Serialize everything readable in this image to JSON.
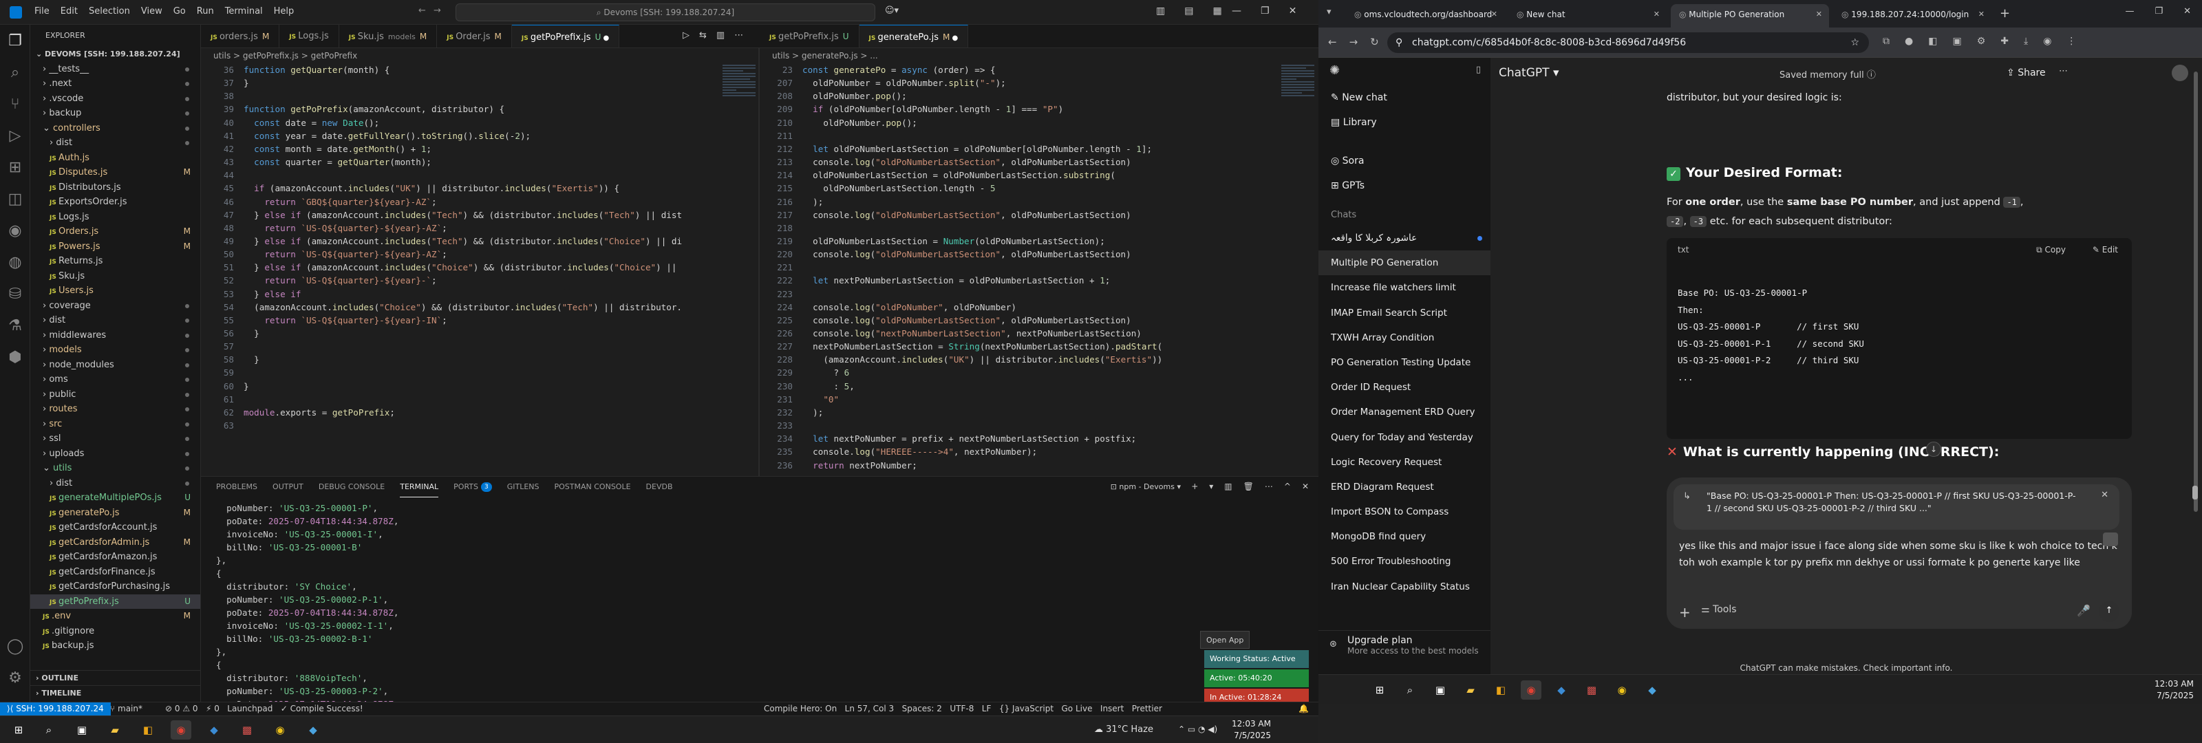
{
  "vscode": {
    "menu": [
      "File",
      "Edit",
      "Selection",
      "View",
      "Go",
      "Run",
      "Terminal",
      "Help"
    ],
    "command_center": "Devoms [SSH: 199.188.207.24]",
    "explorer_title": "EXPLORER",
    "workspace": "DEVOMS [SSH: 199.188.207.24]",
    "tree": [
      {
        "label": "__tests__",
        "indent": 1,
        "kind": "folder"
      },
      {
        "label": ".next",
        "indent": 1,
        "kind": "folder"
      },
      {
        "label": ".vscode",
        "indent": 1,
        "kind": "folder"
      },
      {
        "label": "backup",
        "indent": 1,
        "kind": "folder"
      },
      {
        "label": "controllers",
        "indent": 1,
        "kind": "folder-open",
        "mark": "dot",
        "color": "#e2c08d"
      },
      {
        "label": "dist",
        "indent": 2,
        "kind": "folder"
      },
      {
        "label": "Auth.js",
        "indent": 2,
        "kind": "file",
        "color": "#e2c08d"
      },
      {
        "label": "Disputes.js",
        "indent": 2,
        "kind": "file",
        "mark": "M",
        "color": "#e2c08d"
      },
      {
        "label": "Distributors.js",
        "indent": 2,
        "kind": "file"
      },
      {
        "label": "ExportsOrder.js",
        "indent": 2,
        "kind": "file"
      },
      {
        "label": "Logs.js",
        "indent": 2,
        "kind": "file"
      },
      {
        "label": "Orders.js",
        "indent": 2,
        "kind": "file",
        "mark": "M",
        "color": "#e2c08d"
      },
      {
        "label": "Powers.js",
        "indent": 2,
        "kind": "file",
        "mark": "M",
        "color": "#e2c08d"
      },
      {
        "label": "Returns.js",
        "indent": 2,
        "kind": "file"
      },
      {
        "label": "Sku.js",
        "indent": 2,
        "kind": "file"
      },
      {
        "label": "Users.js",
        "indent": 2,
        "kind": "file",
        "color": "#e2c08d"
      },
      {
        "label": "coverage",
        "indent": 1,
        "kind": "folder"
      },
      {
        "label": "dist",
        "indent": 1,
        "kind": "folder"
      },
      {
        "label": "middlewares",
        "indent": 1,
        "kind": "folder"
      },
      {
        "label": "models",
        "indent": 1,
        "kind": "folder",
        "color": "#e2c08d"
      },
      {
        "label": "node_modules",
        "indent": 1,
        "kind": "folder"
      },
      {
        "label": "oms",
        "indent": 1,
        "kind": "folder"
      },
      {
        "label": "public",
        "indent": 1,
        "kind": "folder"
      },
      {
        "label": "routes",
        "indent": 1,
        "kind": "folder",
        "color": "#e2c08d"
      },
      {
        "label": "src",
        "indent": 1,
        "kind": "folder",
        "color": "#e2c08d"
      },
      {
        "label": "ssl",
        "indent": 1,
        "kind": "folder"
      },
      {
        "label": "uploads",
        "indent": 1,
        "kind": "folder"
      },
      {
        "label": "utils",
        "indent": 1,
        "kind": "folder-open",
        "color": "#73c991"
      },
      {
        "label": "dist",
        "indent": 2,
        "kind": "folder"
      },
      {
        "label": "generateMultiplePOs.js",
        "indent": 2,
        "kind": "file",
        "mark": "U",
        "color": "#73c991"
      },
      {
        "label": "generatePo.js",
        "indent": 2,
        "kind": "file",
        "mark": "M",
        "color": "#e2c08d"
      },
      {
        "label": "getCardsforAccount.js",
        "indent": 2,
        "kind": "file"
      },
      {
        "label": "getCardsforAdmin.js",
        "indent": 2,
        "kind": "file",
        "mark": "M",
        "color": "#e2c08d"
      },
      {
        "label": "getCardsforAmazon.js",
        "indent": 2,
        "kind": "file"
      },
      {
        "label": "getCardsforFinance.js",
        "indent": 2,
        "kind": "file"
      },
      {
        "label": "getCardsforPurchasing.js",
        "indent": 2,
        "kind": "file"
      },
      {
        "label": "getPoPrefix.js",
        "indent": 2,
        "kind": "file",
        "mark": "U",
        "color": "#73c991",
        "selected": true
      },
      {
        "label": ".env",
        "indent": 1,
        "kind": "file",
        "mark": "M",
        "color": "#e2c08d"
      },
      {
        "label": ".gitignore",
        "indent": 1,
        "kind": "file"
      },
      {
        "label": "backup.js",
        "indent": 1,
        "kind": "file"
      }
    ],
    "outline": "OUTLINE",
    "timeline": "TIMELINE",
    "left_tabs": [
      {
        "label": "orders.js",
        "mark": "M"
      },
      {
        "label": "Logs.js",
        "mark": ""
      },
      {
        "label": "Sku.js",
        "extra": "models",
        "mark": "M"
      },
      {
        "label": "Order.js",
        "mark": "M"
      },
      {
        "label": "getPoPrefix.js",
        "mark": "U",
        "active": true
      }
    ],
    "right_tabs": [
      {
        "label": "getPoPrefix.js",
        "mark": "U"
      },
      {
        "label": "generatePo.js",
        "mark": "M",
        "active": true
      }
    ],
    "left_breadcrumb": "utils > getPoPrefix.js > getPoPrefix",
    "right_breadcrumb": "utils > generatePo.js > ...",
    "left_code": [
      {
        "n": "36",
        "t": "function getQuarter(month) {"
      },
      {
        "n": "37",
        "t": "}"
      },
      {
        "n": "38",
        "t": ""
      },
      {
        "n": "39",
        "t": "function getPoPrefix(amazonAccount, distributor) {"
      },
      {
        "n": "40",
        "t": "  const date = new Date();"
      },
      {
        "n": "41",
        "t": "  const year = date.getFullYear().toString().slice(-2);"
      },
      {
        "n": "42",
        "t": "  const month = date.getMonth() + 1;"
      },
      {
        "n": "43",
        "t": "  const quarter = getQuarter(month);"
      },
      {
        "n": "44",
        "t": ""
      },
      {
        "n": "45",
        "t": "  if (amazonAccount.includes(\"UK\") || distributor.includes(\"Exertis\")) {"
      },
      {
        "n": "46",
        "t": "    return `GBQ${quarter}${year}-AZ`;"
      },
      {
        "n": "47",
        "t": "  } else if (amazonAccount.includes(\"Tech\") && (distributor.includes(\"Tech\") || dist"
      },
      {
        "n": "48",
        "t": "    return `US-Q${quarter}-${year}-AZ`;"
      },
      {
        "n": "49",
        "t": "  } else if (amazonAccount.includes(\"Tech\") && (distributor.includes(\"Choice\") || di"
      },
      {
        "n": "50",
        "t": "    return `US-Q${quarter}-${year}-AZ`;"
      },
      {
        "n": "51",
        "t": "  } else if (amazonAccount.includes(\"Choice\") && (distributor.includes(\"Choice\") ||"
      },
      {
        "n": "52",
        "t": "    return `US-Q${quarter}-${year}-`;"
      },
      {
        "n": "53",
        "t": "  } else if"
      },
      {
        "n": "54",
        "t": "  (amazonAccount.includes(\"Choice\") && (distributor.includes(\"Tech\") || distributor."
      },
      {
        "n": "55",
        "t": "    return `US-Q${quarter}-${year}-IN`;"
      },
      {
        "n": "56",
        "t": "  }"
      },
      {
        "n": "57",
        "t": ""
      },
      {
        "n": "58",
        "t": "  }"
      },
      {
        "n": "59",
        "t": ""
      },
      {
        "n": "60",
        "t": "}"
      },
      {
        "n": "61",
        "t": ""
      },
      {
        "n": "62",
        "t": "module.exports = getPoPrefix;"
      },
      {
        "n": "63",
        "t": ""
      }
    ],
    "right_code": [
      {
        "n": "23",
        "t": "const generatePo = async (order) => {"
      },
      {
        "n": "207",
        "t": "  oldPoNumber = oldPoNumber.split(\"-\");"
      },
      {
        "n": "208",
        "t": "  oldPoNumber.pop();"
      },
      {
        "n": "209",
        "t": "  if (oldPoNumber[oldPoNumber.length - 1] === \"P\")"
      },
      {
        "n": "210",
        "t": "    oldPoNumber.pop();"
      },
      {
        "n": "211",
        "t": ""
      },
      {
        "n": "212",
        "t": "  let oldPoNumberLastSection = oldPoNumber[oldPoNumber.length - 1];"
      },
      {
        "n": "213",
        "t": "  console.log(\"oldPoNumberLastSection\", oldPoNumberLastSection)"
      },
      {
        "n": "214",
        "t": "  oldPoNumberLastSection = oldPoNumberLastSection.substring("
      },
      {
        "n": "215",
        "t": "    oldPoNumberLastSection.length - 5"
      },
      {
        "n": "216",
        "t": "  );"
      },
      {
        "n": "217",
        "t": "  console.log(\"oldPoNumberLastSection\", oldPoNumberLastSection)"
      },
      {
        "n": "218",
        "t": ""
      },
      {
        "n": "219",
        "t": "  oldPoNumberLastSection = Number(oldPoNumberLastSection);"
      },
      {
        "n": "220",
        "t": "  console.log(\"oldPoNumberLastSection\", oldPoNumberLastSection)"
      },
      {
        "n": "221",
        "t": ""
      },
      {
        "n": "222",
        "t": "  let nextPoNumberLastSection = oldPoNumberLastSection + 1;"
      },
      {
        "n": "223",
        "t": ""
      },
      {
        "n": "224",
        "t": "  console.log(\"oldPoNumber\", oldPoNumber)"
      },
      {
        "n": "225",
        "t": "  console.log(\"oldPoNumberLastSection\", oldPoNumberLastSection)"
      },
      {
        "n": "226",
        "t": "  console.log(\"nextPoNumberLastSection\", nextPoNumberLastSection)"
      },
      {
        "n": "227",
        "t": "  nextPoNumberLastSection = String(nextPoNumberLastSection).padStart("
      },
      {
        "n": "228",
        "t": "    (amazonAccount.includes(\"UK\") || distributor.includes(\"Exertis\"))"
      },
      {
        "n": "229",
        "t": "      ? 6"
      },
      {
        "n": "230",
        "t": "      : 5,"
      },
      {
        "n": "231",
        "t": "    \"0\""
      },
      {
        "n": "232",
        "t": "  );"
      },
      {
        "n": "233",
        "t": ""
      },
      {
        "n": "234",
        "t": "  let nextPoNumber = prefix + nextPoNumberLastSection + postfix;"
      },
      {
        "n": "235",
        "t": "  console.log(\"HEREEE----->4\", nextPoNumber);"
      },
      {
        "n": "236",
        "t": "  return nextPoNumber;"
      }
    ],
    "panel_tabs": [
      "PROBLEMS",
      "OUTPUT",
      "DEBUG CONSOLE",
      "TERMINAL",
      "PORTS",
      "GITLENS",
      "POSTMAN CONSOLE",
      "DEVDB"
    ],
    "ports_badge": "3",
    "terminal_name": "npm - Devoms",
    "terminal_lines": [
      "  poNumber: 'US-Q3-25-00001-P',",
      "  poDate: 2025-07-04T18:44:34.878Z,",
      "  invoiceNo: 'US-Q3-25-00001-I',",
      "  billNo: 'US-Q3-25-00001-B'",
      "},",
      "{",
      "  distributor: 'SY Choice',",
      "  poNumber: 'US-Q3-25-00002-P-1',",
      "  poDate: 2025-07-04T18:44:34.878Z,",
      "  invoiceNo: 'US-Q3-25-00002-I-1',",
      "  billNo: 'US-Q3-25-00002-B-1'",
      "},",
      "{",
      "  distributor: '888VoipTech',",
      "  poNumber: 'US-Q3-25-00003-P-2',",
      "  poDate: 2025-07-04T18:44:34.878Z,"
    ],
    "open_app": "Open App",
    "working_status": "Working Status: Active",
    "active_time": "Active: 05:40:20",
    "inactive_time": "In Active: 01:28:24",
    "status_left": "SSH: 199.188.207.24",
    "status_branch": "main*",
    "status_items": "⊘ 0 ⚠ 0   ⚡ 0   Launchpad   ✓ Compile Success!",
    "status_right": "Compile Hero: On   Ln 57, Col 3   Spaces: 2   UTF-8   LF   {} JavaScript   Go Live   Insert   Prettier",
    "tray_weather": "31°C  Haze",
    "tray_time": "12:03 AM",
    "tray_date": "7/5/2025"
  },
  "chrome": {
    "tabs": [
      {
        "label": "oms.vcloudtech.org/dashboard"
      },
      {
        "label": "New chat"
      },
      {
        "label": "Multiple PO Generation",
        "active": true
      },
      {
        "label": "199.188.207.24:10000/login"
      }
    ],
    "url": "chatgpt.com/c/685d4b0f-8c8c-8008-b3cd-8696d7d49f56",
    "model": "ChatGPT",
    "saved_memory": "Saved memory full",
    "share": "Share",
    "side": {
      "new_chat": "New chat",
      "library": "Library",
      "sora": "Sora",
      "gpts": "GPTs",
      "chats_label": "Chats",
      "chats": [
        "عاشورہ کربلا کا واقعہ",
        "Multiple PO Generation",
        "Increase file watchers limit",
        "IMAP Email Search Script",
        "TXWH Array Condition",
        "PO Generation Testing Update",
        "Order ID Request",
        "Order Management ERD Query",
        "Query for Today and Yesterday",
        "Logic Recovery Request",
        "ERD Diagram Request",
        "Import BSON to Compass",
        "MongoDB find query",
        "500 Error Troubleshooting",
        "Iran Nuclear Capability Status"
      ],
      "upgrade": "Upgrade plan",
      "upgrade_sub": "More access to the best models"
    },
    "msg_top": "distributor, but your desired logic is:",
    "desired_heading": "Your Desired Format:",
    "desired_line_a": "For ",
    "desired_line_b": "one order",
    "desired_line_c": ", use the ",
    "desired_line_d": "same base PO number",
    "desired_line_e": ", and just append",
    "desired_line_f": "-1",
    "desired_line2_a": "-2",
    "desired_line2_b": "-3",
    "desired_line2_c": " etc. for each subsequent distributor:",
    "code_lang": "txt",
    "copy": "Copy",
    "edit": "Edit",
    "code_block": [
      "Base PO: US-Q3-25-00001-P",
      "Then:",
      "US-Q3-25-00001-P       // first SKU",
      "US-Q3-25-00001-P-1     // second SKU",
      "US-Q3-25-00001-P-2     // third SKU",
      "..."
    ],
    "wrong_heading": "What is currently happening (INCORRECT):",
    "quote": "\"Base PO: US-Q3-25-00001-P Then: US-Q3-25-00001-P // first SKU US-Q3-25-00001-P-1 // second SKU US-Q3-25-00001-P-2 // third SKU ...\"",
    "draft": "yes like this and major issue i face along side when some sku is like k woh choice to tech k toh woh example k tor py prefix mn dekhye or ussi formate k po generte karye like",
    "tools": "Tools",
    "disclaimer": "ChatGPT can make mistakes. Check important info.",
    "tray_time": "12:03 AM",
    "tray_date": "7/5/2025"
  }
}
